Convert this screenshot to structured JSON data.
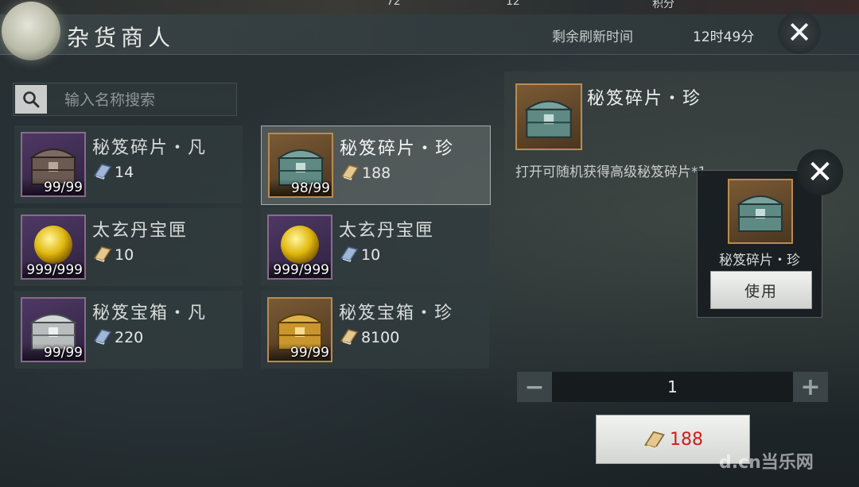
{
  "top_bar": {
    "resources": [
      "72",
      "12",
      "积分"
    ]
  },
  "header": {
    "title": "杂货商人",
    "refresh_label": "剩余刷新时间",
    "refresh_time": "12时49分"
  },
  "search": {
    "placeholder": "输入名称搜索",
    "icon": "search-icon"
  },
  "items": [
    {
      "name": "秘笈碎片・凡",
      "price": "14",
      "count": "99/99",
      "icon": "iron-chest-icon"
    },
    {
      "name": "秘笈碎片・珍",
      "price": "188",
      "count": "98/99",
      "icon": "jade-chest-icon",
      "selected": true
    },
    {
      "name": "太玄丹宝匣",
      "price": "10",
      "count": "999/999",
      "icon": "golden-orb-icon"
    },
    {
      "name": "太玄丹宝匣",
      "price": "10",
      "count": "999/999",
      "icon": "golden-orb-icon"
    },
    {
      "name": "秘笈宝箱・凡",
      "price": "220",
      "count": "99/99",
      "icon": "silver-chest-icon"
    },
    {
      "name": "秘笈宝箱・珍",
      "price": "8100",
      "count": "99/99",
      "icon": "gold-chest-icon"
    }
  ],
  "detail": {
    "name": "秘笈碎片・珍",
    "description": "打开可随机获得高级秘笈碎片*1"
  },
  "popup": {
    "name": "秘笈碎片・珍",
    "use_label": "使用"
  },
  "purchase": {
    "quantity": "1",
    "minus_label": "−",
    "plus_label": "+",
    "total_price": "188"
  },
  "watermark": "d.cn当乐网",
  "colors": {
    "price_red": "#d21d1d",
    "rare_border": "#b88c52",
    "common_border": "#8a6a8e"
  }
}
